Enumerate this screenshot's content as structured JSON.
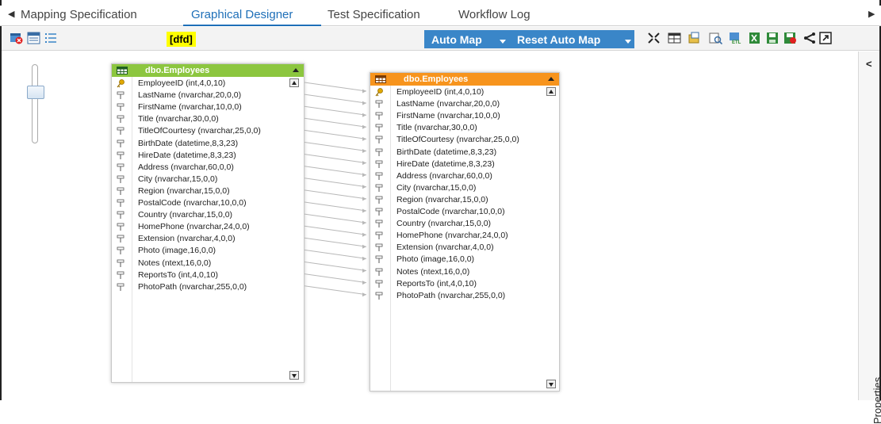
{
  "tabs": {
    "items": [
      {
        "label": "Mapping Specification",
        "active": false
      },
      {
        "label": "Graphical Designer",
        "active": true
      },
      {
        "label": "Test Specification",
        "active": false
      },
      {
        "label": "Workflow Log",
        "active": false
      }
    ]
  },
  "toolbar": {
    "tag": "[dfd]",
    "auto_map": "Auto Map",
    "reset_auto_map": "Reset Auto Map",
    "left_icons": [
      "delete-mapping-icon",
      "grid-view-icon",
      "list-view-icon"
    ],
    "right_icons": [
      "collapse-icon",
      "table-view-icon",
      "export-icon",
      "preview-icon",
      "etl-icon",
      "excel-icon",
      "save-icon",
      "record-icon",
      "share-icon",
      "maximize-icon"
    ]
  },
  "source_entity": {
    "title": "dbo.Employees",
    "header_color": "#8cc63f",
    "columns": [
      "EmployeeID (int,4,0,10)",
      "LastName (nvarchar,20,0,0)",
      "FirstName (nvarchar,10,0,0)",
      "Title (nvarchar,30,0,0)",
      "TitleOfCourtesy (nvarchar,25,0,0)",
      "BirthDate (datetime,8,3,23)",
      "HireDate (datetime,8,3,23)",
      "Address (nvarchar,60,0,0)",
      "City (nvarchar,15,0,0)",
      "Region (nvarchar,15,0,0)",
      "PostalCode (nvarchar,10,0,0)",
      "Country (nvarchar,15,0,0)",
      "HomePhone (nvarchar,24,0,0)",
      "Extension (nvarchar,4,0,0)",
      "Photo (image,16,0,0)",
      "Notes (ntext,16,0,0)",
      "ReportsTo (int,4,0,10)",
      "PhotoPath (nvarchar,255,0,0)"
    ]
  },
  "target_entity": {
    "title": "dbo.Employees",
    "header_color": "#f7941d",
    "columns": [
      "EmployeeID (int,4,0,10)",
      "LastName (nvarchar,20,0,0)",
      "FirstName (nvarchar,10,0,0)",
      "Title (nvarchar,30,0,0)",
      "TitleOfCourtesy (nvarchar,25,0,0)",
      "BirthDate (datetime,8,3,23)",
      "HireDate (datetime,8,3,23)",
      "Address (nvarchar,60,0,0)",
      "City (nvarchar,15,0,0)",
      "Region (nvarchar,15,0,0)",
      "PostalCode (nvarchar,10,0,0)",
      "Country (nvarchar,15,0,0)",
      "HomePhone (nvarchar,24,0,0)",
      "Extension (nvarchar,4,0,0)",
      "Photo (image,16,0,0)",
      "Notes (ntext,16,0,0)",
      "ReportsTo (int,4,0,10)",
      "PhotoPath (nvarchar,255,0,0)"
    ]
  },
  "right_panel": {
    "label": "Properties"
  },
  "accent_color": "#1e6fb8"
}
